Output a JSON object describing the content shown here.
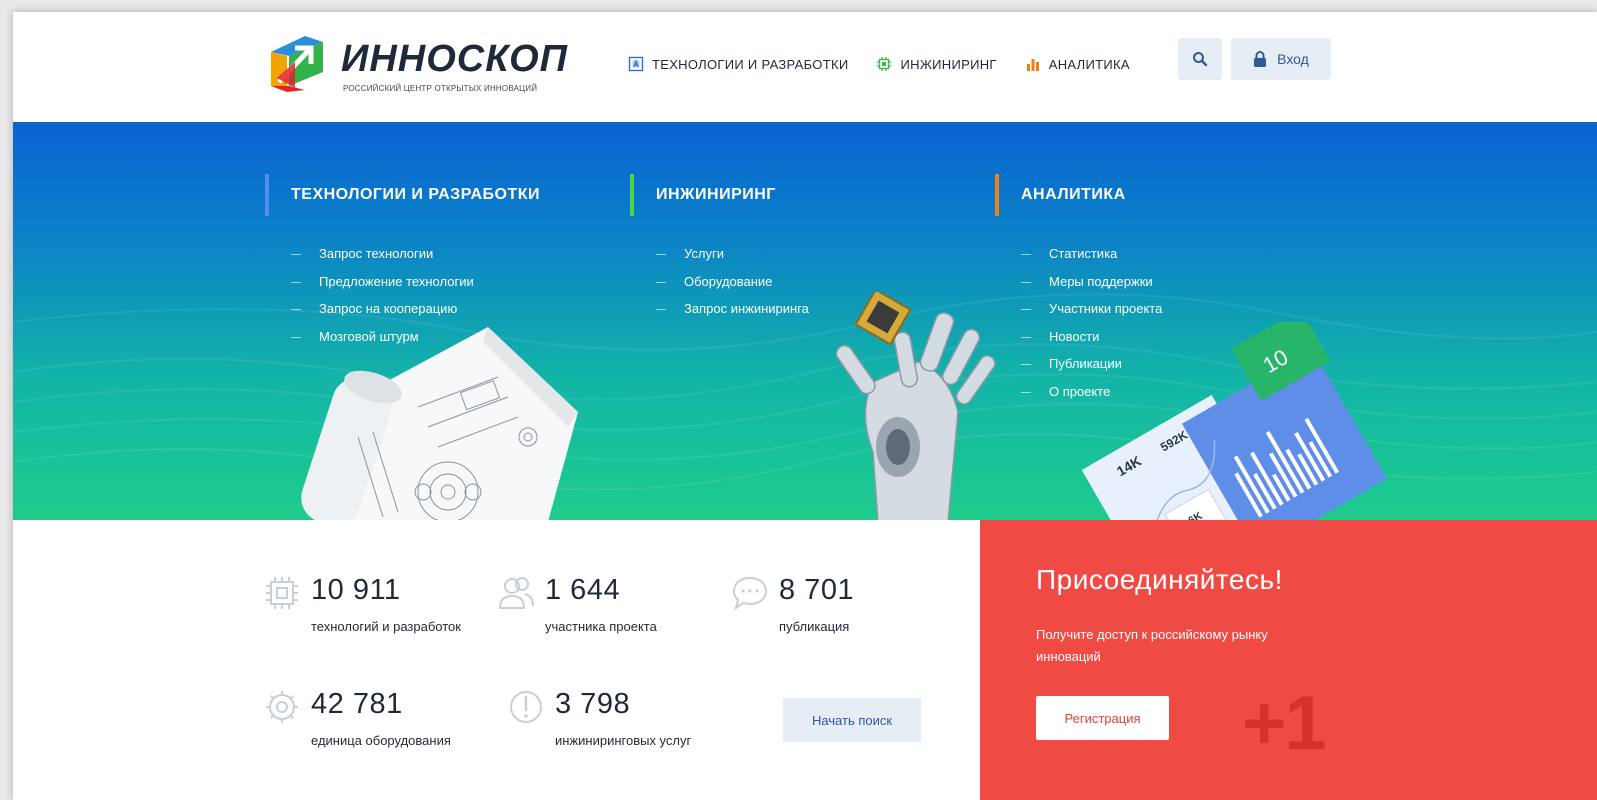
{
  "header": {
    "logo_name": "ИННОСКОП",
    "logo_subtitle": "РОССИЙСКИЙ ЦЕНТР ОТКРЫТЫХ ИННОВАЦИЙ",
    "nav": [
      {
        "label": "ТЕХНОЛОГИИ И РАЗРАБОТКИ",
        "icon": "chip-box-icon",
        "color": "#2f6fd6"
      },
      {
        "label": "ИНЖИНИРИНГ",
        "icon": "gear-chip-icon",
        "color": "#3cb54a"
      },
      {
        "label": "АНАЛИТИКА",
        "icon": "bar-chart-icon",
        "color": "#f07f1a"
      }
    ],
    "search_icon": "search-icon",
    "login_label": "Вход",
    "login_icon": "lock-icon"
  },
  "hero": {
    "columns": [
      {
        "title": "ТЕХНОЛОГИИ И РАЗРАБОТКИ",
        "accent": "#4f8ef0",
        "items": [
          "Запрос технологии",
          "Предложение технологии",
          "Запрос на кооперацию",
          "Мозговой штурм"
        ]
      },
      {
        "title": "ИНЖИНИРИНГ",
        "accent": "#4fd14a",
        "items": [
          "Услуги",
          "Оборудование",
          "Запрос инжиниринга"
        ]
      },
      {
        "title": "АНАЛИТИКА",
        "accent": "#f07f1a",
        "items": [
          "Статистика",
          "Меры поддержки",
          "Участники проекта",
          "Новости",
          "Публикации",
          "О проекте"
        ]
      }
    ],
    "analytics_card": {
      "badge": "10",
      "value_a": "14K",
      "value_b": "592K",
      "value_c": "1.6K"
    }
  },
  "stats": {
    "items": [
      {
        "number": "10 911",
        "label": "технологий и разработок",
        "icon": "chip-icon"
      },
      {
        "number": "1 644",
        "label": "участника проекта",
        "icon": "users-icon"
      },
      {
        "number": "8 701",
        "label": "публикация",
        "icon": "chat-bubble-icon"
      },
      {
        "number": "42 781",
        "label": "единица оборудования",
        "icon": "gear-icon"
      },
      {
        "number": "3 798",
        "label": "инжиниринговых услуг",
        "icon": "exclamation-icon"
      }
    ],
    "start_search_label": "Начать поиск"
  },
  "join": {
    "title": "Присоединяйтесь!",
    "text": "Получите доступ к российскому рынку инноваций",
    "register_label": "Регистрация",
    "plus_one": "+1",
    "color": "#f04a45"
  }
}
